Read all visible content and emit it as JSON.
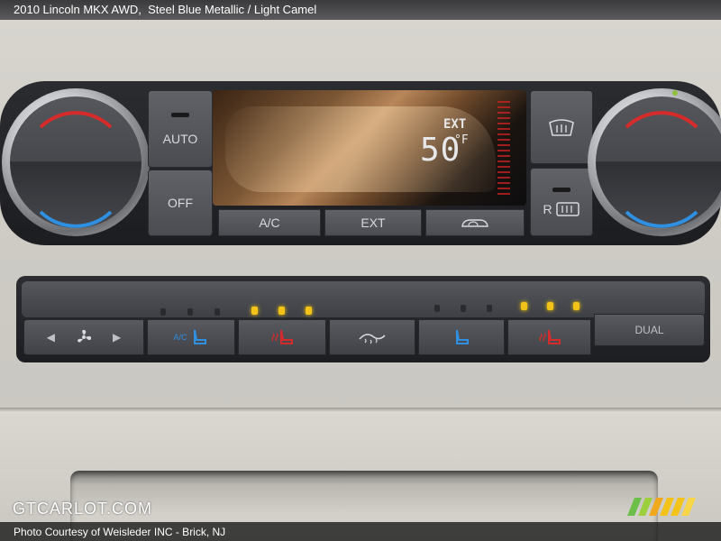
{
  "caption": {
    "vehicle": "2010 Lincoln MKX AWD,",
    "trim": "Steel Blue Metallic / Light Camel"
  },
  "footer": {
    "credit": "Photo Courtesy of Weisleder INC - Brick, NJ",
    "logo": "GTCARLOT.COM"
  },
  "upper_controls": {
    "auto_label": "AUTO",
    "off_label": "OFF",
    "ac_label": "A/C",
    "ext_label": "EXT",
    "display": {
      "mode": "EXT",
      "temperature": "50",
      "unit": "°F"
    },
    "rear_defrost_label": "R"
  },
  "lower_controls": {
    "dual_label": "DUAL",
    "fan_left": "◀",
    "fan_right": "▶",
    "ac_seat_label": "A/C"
  },
  "colors": {
    "hot": "#d62b2b",
    "cold": "#2f8fe0",
    "led": "#f3c319"
  },
  "icons": [
    "fan-icon",
    "front-defrost-icon",
    "rear-defrost-icon",
    "recirculation-icon",
    "heated-seat-icon",
    "cooled-seat-icon",
    "heated-wheel-icon"
  ]
}
